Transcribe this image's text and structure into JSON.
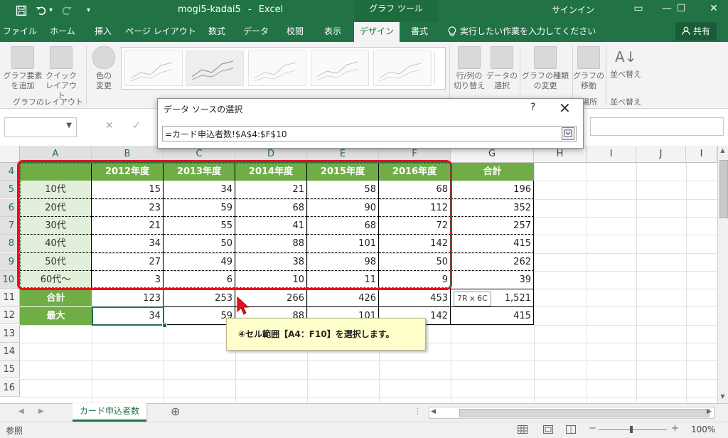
{
  "titlebar": {
    "file_title": "mogi5-kadai5",
    "separator": "-",
    "app_name": "Excel",
    "contextual_tab_group": "グラフ ツール",
    "signin": "サインイン",
    "window_controls": {
      "restore_ribbon": "▭",
      "minimize": "—",
      "maximize": "☐",
      "close": "✕"
    },
    "quick_access": {
      "undo_arrow": "▾",
      "customize": "▾"
    }
  },
  "tabs": [
    {
      "label": "ファイル"
    },
    {
      "label": "ホーム"
    },
    {
      "label": "挿入"
    },
    {
      "label": "ページ レイアウト"
    },
    {
      "label": "数式"
    },
    {
      "label": "データ"
    },
    {
      "label": "校閲"
    },
    {
      "label": "表示"
    },
    {
      "label": "デザイン",
      "active": true
    },
    {
      "label": "書式"
    }
  ],
  "tell_me": "実行したい作業を入力してください",
  "share_label": "共有",
  "ribbon": {
    "add_chart_element": "グラフ要素\nを追加",
    "quick_layout": "クイック\nレイアウト",
    "change_colors": "色の\n変更",
    "switch_row_col": "行/列の\n切り替え",
    "select_data": "データの\n選択",
    "change_chart_type": "グラフの種類\nの変更",
    "move_chart": "グラフの\n移動",
    "sort": "並べ替え",
    "group_layouts": "グラフのレイアウト",
    "group_location": "場所",
    "group_sort": "並べ替え"
  },
  "formula_bar": {
    "cancel": "✕",
    "enter": "✓"
  },
  "dialog": {
    "title": "データ ソースの選択",
    "help": "?",
    "close": "✕",
    "range_value": "=カード申込者数!$A$4:$F$10"
  },
  "columns": [
    "A",
    "B",
    "C",
    "D",
    "E",
    "F",
    "G",
    "H",
    "I",
    "J",
    "I"
  ],
  "rows": [
    "4",
    "5",
    "6",
    "7",
    "8",
    "9",
    "10",
    "11",
    "12",
    "13",
    "14",
    "15",
    "16"
  ],
  "table": {
    "header": [
      "2012年度",
      "2013年度",
      "2014年度",
      "2015年度",
      "2016年度",
      "合計"
    ],
    "rows": [
      {
        "label": "10代",
        "values": [
          "15",
          "34",
          "21",
          "58",
          "68"
        ],
        "total": "196"
      },
      {
        "label": "20代",
        "values": [
          "23",
          "59",
          "68",
          "90",
          "112"
        ],
        "total": "352"
      },
      {
        "label": "30代",
        "values": [
          "21",
          "55",
          "41",
          "68",
          "72"
        ],
        "total": "257"
      },
      {
        "label": "40代",
        "values": [
          "34",
          "50",
          "88",
          "101",
          "142"
        ],
        "total": "415"
      },
      {
        "label": "50代",
        "values": [
          "27",
          "49",
          "38",
          "98",
          "50"
        ],
        "total": "262"
      },
      {
        "label": "60代～",
        "values": [
          "3",
          "6",
          "10",
          "11",
          "9"
        ],
        "total": "39"
      }
    ],
    "sum_row": {
      "label": "合計",
      "values": [
        "123",
        "253",
        "266",
        "426",
        "453"
      ],
      "total": "1,521"
    },
    "max_row": {
      "label": "最大",
      "values": [
        "34",
        "59",
        "88",
        "101",
        "142"
      ],
      "total": "415"
    }
  },
  "selection_tooltip": "7R x 6C",
  "callout": "④セル範囲【A4：F10】を選択します。",
  "sheet_tab": "カード申込者数",
  "add_sheet": "⊕",
  "status": {
    "mode": "参照",
    "zoom": "100%",
    "zoom_minus": "−",
    "zoom_plus": "+"
  },
  "colors": {
    "excel_green": "#217346",
    "header_green": "#70ad47",
    "label_light_green": "#e2efda",
    "highlight_red": "#e8101a",
    "callout_yellow": "#ffffcc"
  }
}
